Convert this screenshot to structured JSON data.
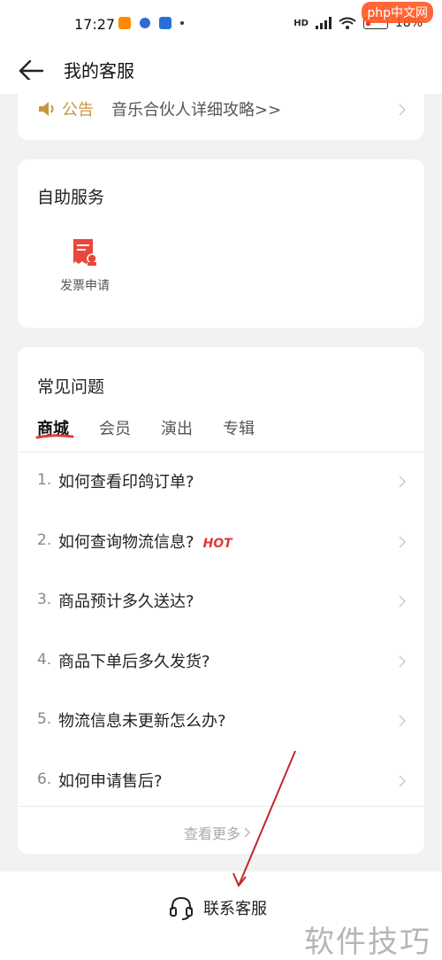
{
  "status_bar": {
    "time": "17:27",
    "battery": "18%",
    "network": "HD"
  },
  "nav": {
    "title": "我的客服"
  },
  "notice": {
    "tag": "公告",
    "text": "音乐合伙人详细攻略>>"
  },
  "self_service": {
    "title": "自助服务",
    "items": [
      {
        "label": "发票申请",
        "icon": "invoice-icon"
      }
    ]
  },
  "faq": {
    "title": "常见问题",
    "tabs": [
      {
        "label": "商城",
        "active": true
      },
      {
        "label": "会员",
        "active": false
      },
      {
        "label": "演出",
        "active": false
      },
      {
        "label": "专辑",
        "active": false
      }
    ],
    "items": [
      {
        "num": "1.",
        "text": "如何查看印鸽订单?"
      },
      {
        "num": "2.",
        "text": "如何查询物流信息?",
        "badge": "HOT"
      },
      {
        "num": "3.",
        "text": "商品预计多久送达?"
      },
      {
        "num": "4.",
        "text": "商品下单后多久发货?"
      },
      {
        "num": "5.",
        "text": "物流信息未更新怎么办?"
      },
      {
        "num": "6.",
        "text": "如何申请售后?"
      }
    ],
    "more_label": "查看更多"
  },
  "bottom": {
    "contact_label": "联系客服"
  },
  "watermark": "软件技巧",
  "badge_text": "php中文网",
  "colors": {
    "accent_gold": "#c8963e",
    "hot_red": "#e03a3a",
    "tab_underline": "#e03a3a"
  }
}
